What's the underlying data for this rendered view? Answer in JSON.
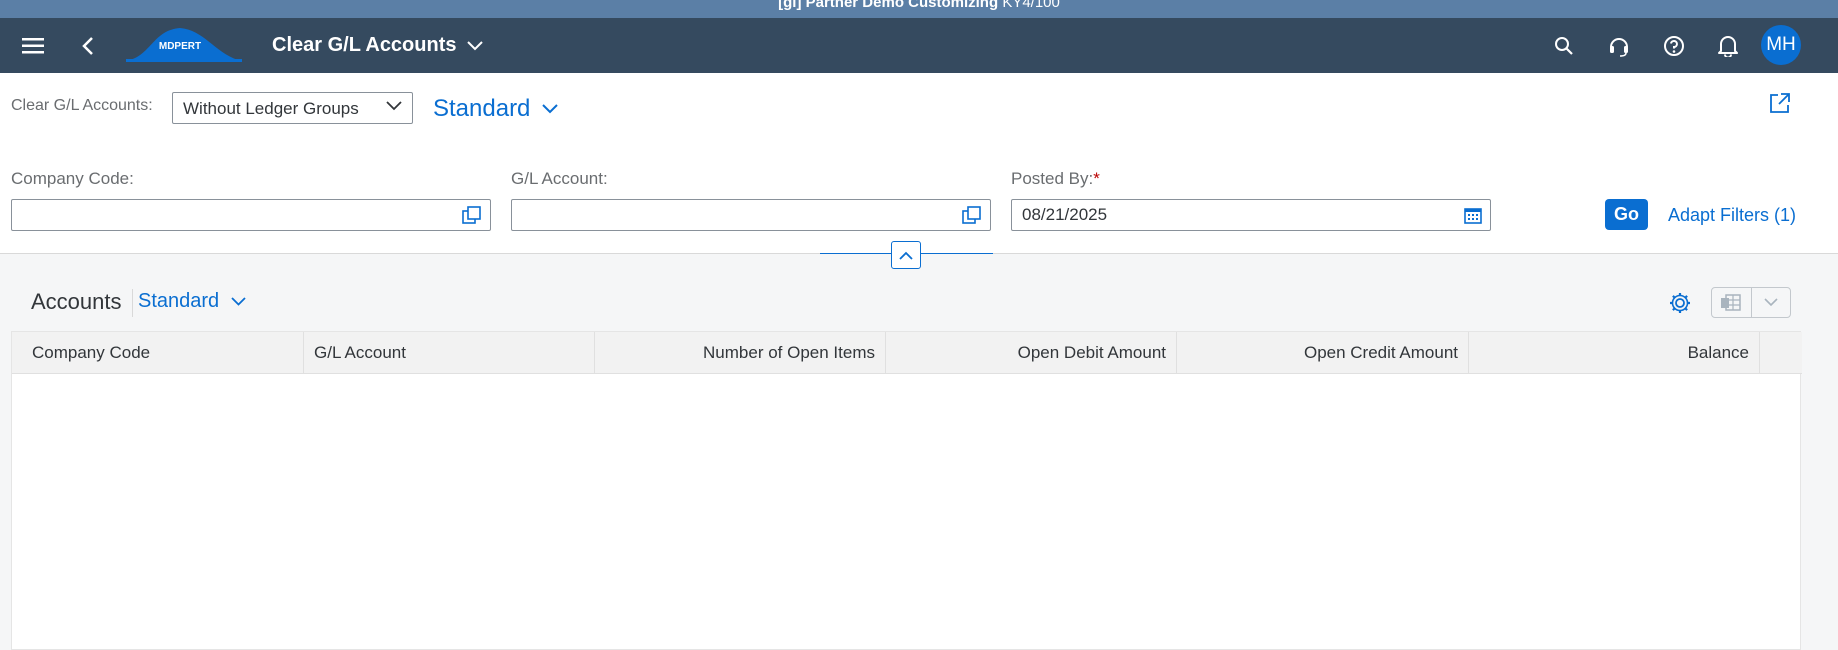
{
  "system_bar": {
    "text": "[gi] Partner Demo Customizing",
    "system_id": "KY4/100"
  },
  "shell": {
    "menu_icon": "hamburger-icon",
    "back_icon": "back-icon",
    "logo_text": "MDPERT",
    "app_title": "Clear G/L Accounts",
    "avatar_initials": "MH",
    "brand_color": "#354a5f",
    "accent_color": "#0a6ed1"
  },
  "header": {
    "variant_label": "Clear G/L Accounts:",
    "ledger_select_value": "Without Ledger Groups",
    "page_variant": "Standard",
    "filters": {
      "company_code_label": "Company Code:",
      "company_code_value": "",
      "gl_account_label": "G/L Account:",
      "gl_account_value": "",
      "posted_by_label": "Posted By:",
      "posted_by_required": "*",
      "posted_by_value": "08/21/2025"
    },
    "go_label": "Go",
    "adapt_filters_label": "Adapt Filters (1)"
  },
  "table": {
    "title": "Accounts",
    "variant": "Standard",
    "columns": [
      "Company Code",
      "G/L Account",
      "Number of Open Items",
      "Open Debit Amount",
      "Open Credit Amount",
      "Balance"
    ],
    "rows": []
  }
}
